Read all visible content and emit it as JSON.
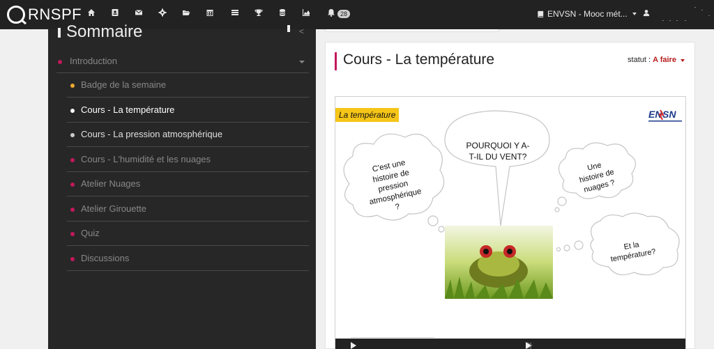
{
  "nav": {
    "brand": "RNSPF",
    "notifications_count": "28",
    "user_org": "ENVSN - Mooc mét...",
    "icons": [
      "home-icon",
      "id-card-icon",
      "envelope-icon",
      "gear-icon",
      "folder-open-icon",
      "calendar-icon",
      "list-icon",
      "trophy-icon",
      "database-icon",
      "chart-icon",
      "bell-icon",
      "book-icon",
      "user-icon"
    ]
  },
  "sidebar": {
    "title": "Sommaire",
    "section": {
      "label": "Introduction",
      "dot_color": "#c2185b"
    },
    "items": [
      {
        "label": "Badge de la semaine",
        "dot_color": "#f0a830",
        "text_color": "#888888"
      },
      {
        "label": "Cours - La température",
        "dot_color": "#ffffff",
        "text_color": "#ffffff"
      },
      {
        "label": "Cours - La pression atmosphérique",
        "dot_color": "#cccccc",
        "text_color": "#e0e0e0"
      },
      {
        "label": "Cours - L'humidité et les nuages",
        "dot_color": "#c2185b",
        "text_color": "#888888"
      },
      {
        "label": "Atelier Nuages",
        "dot_color": "#c2185b",
        "text_color": "#888888"
      },
      {
        "label": "Atelier Girouette",
        "dot_color": "#c2185b",
        "text_color": "#888888"
      },
      {
        "label": "Quiz",
        "dot_color": "#c2185b",
        "text_color": "#888888"
      },
      {
        "label": "Discussions",
        "dot_color": "#c2185b",
        "text_color": "#888888"
      }
    ]
  },
  "main": {
    "title": "Cours - La température",
    "status_label": "statut :",
    "status_value": "A faire",
    "accent_color": "#c2185b"
  },
  "slide": {
    "tag": "La température",
    "logo": "ENVSN",
    "bubble_center": "POURQUOI Y A-\nT-IL DU VENT?",
    "bubble_left": "C'est une\nhistoire de\npression\natmosphérique\n?",
    "bubble_right_top": "Une\nhistoire de\nnuages ?",
    "bubble_right_bottom": "Et la\ntempérature?"
  }
}
